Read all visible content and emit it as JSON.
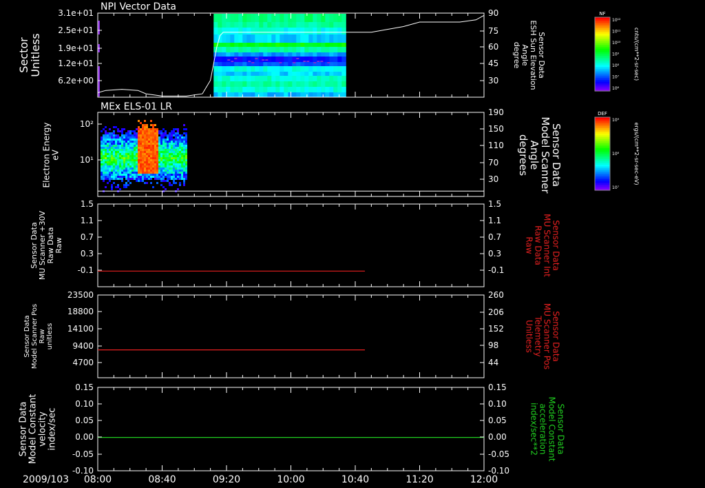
{
  "colors": {
    "background": "#000000",
    "axis": "#ffffff",
    "red_trace": "#e82020",
    "green_trace": "#20d020"
  },
  "time_axis": {
    "date_label": "2009/103",
    "ticks": [
      "08:00",
      "08:40",
      "09:20",
      "10:00",
      "10:40",
      "11:20",
      "12:00"
    ]
  },
  "colorbars": [
    {
      "title": "NF",
      "tick_labels": [
        "10¹²",
        "10¹¹",
        "10¹⁰",
        "10⁹",
        "10⁸",
        "10⁷",
        "10⁶"
      ],
      "unit": "cnts/(cm**2-sr-sec)"
    },
    {
      "title": "DEF",
      "tick_labels": [
        "10⁹",
        "10⁸",
        "10⁷"
      ],
      "unit": "ergs/(cm**2-sr-sec-eV)"
    }
  ],
  "chart_data": [
    {
      "type": "heatmap",
      "title": "NPI Vector Data",
      "ylabel": [
        "Sector",
        "Unitless"
      ],
      "y_ticks": [
        "3.1e+01",
        "2.5e+01",
        "1.9e+01",
        "1.2e+01",
        "6.2e+00"
      ],
      "x": [
        "08:00",
        "08:40",
        "09:20",
        "10:00",
        "10:40",
        "11:20",
        "12:00"
      ],
      "data_time_range": [
        "09:12",
        "10:33"
      ],
      "y2label": [
        "Sensor Data",
        "ESH Sun Elevation",
        "Angle",
        "degree"
      ],
      "y2_ticks": [
        "90",
        "75",
        "60",
        "45",
        "30"
      ],
      "y2lim": [
        15,
        90
      ],
      "overlay_line": {
        "color": "#ffffff",
        "x": [
          "08:00",
          "08:05",
          "08:15",
          "08:25",
          "08:30",
          "08:40",
          "08:55",
          "09:05",
          "09:10",
          "09:14",
          "09:16",
          "09:18",
          "09:20",
          "10:40",
          "10:50",
          "11:10",
          "11:20",
          "11:45",
          "11:55",
          "12:00"
        ],
        "y": [
          19,
          21,
          22,
          21,
          18,
          16,
          16,
          18,
          30,
          60,
          70,
          73,
          73,
          73,
          73,
          78,
          82,
          82,
          84,
          88
        ]
      }
    },
    {
      "type": "heatmap",
      "title": "MEx ELS-01 LR",
      "ylabel": [
        "Electron Energy",
        "eV"
      ],
      "y_ticks": [
        "10²",
        "10¹"
      ],
      "yscale": "log",
      "data_time_range": [
        "08:00",
        "08:55"
      ],
      "y2label": [
        "Sensor Data",
        "Model Scanner",
        "Angle",
        "degrees"
      ],
      "y2_ticks": [
        "190",
        "150",
        "110",
        "70",
        "30"
      ],
      "y2lim": [
        0,
        190
      ],
      "overlay_line": {
        "color": "#ffffff",
        "x": [
          "08:00",
          "12:00"
        ],
        "y": [
          12,
          12
        ]
      }
    },
    {
      "type": "line",
      "ylabel": [
        "Sensor Data",
        "MU Scanner +30V",
        "Raw Data",
        "Raw"
      ],
      "y_ticks": [
        "1.5",
        "1.1",
        "0.7",
        "0.3",
        "-0.1"
      ],
      "ylim": [
        -0.35,
        1.5
      ],
      "y2label": [
        "Sensor Data",
        "MU Scanner Int",
        "Raw Data",
        "Raw"
      ],
      "y2_ticks": [
        "1.5",
        "1.1",
        "0.7",
        "0.3",
        "-0.1"
      ],
      "series": [
        {
          "color": "#e82020",
          "x": [
            "08:00",
            "10:46"
          ],
          "y": [
            0.0,
            0.0
          ]
        }
      ]
    },
    {
      "type": "line",
      "ylabel": [
        "Sensor Data",
        "Model Scanner Pos",
        "Raw",
        "unitless"
      ],
      "y_ticks": [
        "23500",
        "18800",
        "14100",
        "9400",
        "4700"
      ],
      "ylim": [
        0,
        23500
      ],
      "y2label": [
        "Sensor Data",
        "MU Scanner Pos",
        "Telemetry",
        "Unitless"
      ],
      "y2_ticks": [
        "260",
        "206",
        "152",
        "98",
        "44"
      ],
      "series": [
        {
          "color": "#e82020",
          "x": [
            "08:00",
            "10:46"
          ],
          "y": [
            7900,
            7900
          ]
        }
      ]
    },
    {
      "type": "line",
      "ylabel": [
        "Sensor Data",
        "Model Constant",
        "velocity",
        "index/sec"
      ],
      "y_ticks": [
        "0.15",
        "0.10",
        "0.05",
        "0.00",
        "-0.05",
        "-0.10"
      ],
      "ylim": [
        -0.1,
        0.15
      ],
      "y2label": [
        "Sensor Data",
        "Model Constant",
        "acceleration",
        "index/sec**2"
      ],
      "y2_ticks": [
        "0.15",
        "0.10",
        "0.05",
        "0.00",
        "-0.05",
        "-0.10"
      ],
      "series": [
        {
          "color": "#20d020",
          "x": [
            "08:00",
            "12:00"
          ],
          "y": [
            0.0,
            0.0
          ]
        }
      ]
    }
  ]
}
